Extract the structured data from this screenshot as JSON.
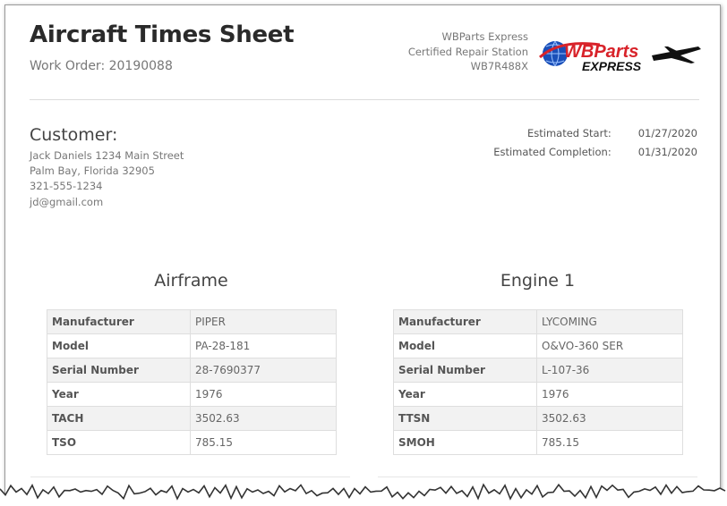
{
  "header": {
    "title": "Aircraft Times Sheet",
    "work_order": "Work Order: 20190088"
  },
  "company": {
    "name": "WBParts Express",
    "line2": "Certified Repair Station",
    "line3": "WB7R488X",
    "logo_text_top": "WBParts",
    "logo_text_bottom": "EXPRESS",
    "logo_color_blue": "#1a4fb8",
    "logo_color_red": "#d8232a"
  },
  "customer": {
    "heading": "Customer:",
    "lines": [
      "Jack Daniels 1234 Main Street",
      "Palm Bay, Florida 32905",
      "321-555-1234",
      "jd@gmail.com"
    ]
  },
  "dates": [
    {
      "label": "Estimated Start:",
      "value": "01/27/2020"
    },
    {
      "label": "Estimated Completion:",
      "value": "01/31/2020"
    }
  ],
  "airframe": {
    "title": "Airframe",
    "rows": [
      {
        "key": "Manufacturer",
        "value": "PIPER"
      },
      {
        "key": "Model",
        "value": "PA-28-181"
      },
      {
        "key": "Serial Number",
        "value": "28-7690377"
      },
      {
        "key": "Year",
        "value": "1976"
      },
      {
        "key": "TACH",
        "value": "3502.63"
      },
      {
        "key": "TSO",
        "value": "785.15"
      }
    ]
  },
  "engine": {
    "title": "Engine 1",
    "rows": [
      {
        "key": "Manufacturer",
        "value": "LYCOMING"
      },
      {
        "key": "Model",
        "value": "O&VO-360 SER"
      },
      {
        "key": "Serial Number",
        "value": "L-107-36"
      },
      {
        "key": "Year",
        "value": "1976"
      },
      {
        "key": "TTSN",
        "value": "3502.63"
      },
      {
        "key": "SMOH",
        "value": "785.15"
      }
    ]
  }
}
